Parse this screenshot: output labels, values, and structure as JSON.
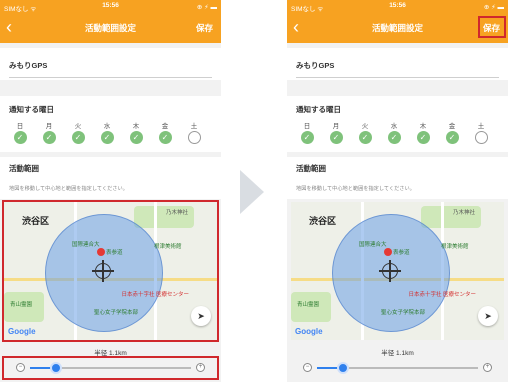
{
  "status": {
    "carrier": "SIMなし ᯤ",
    "time": "15:56",
    "battery": "⊕ ⚡ ▬"
  },
  "nav": {
    "back": "‹",
    "title": "活動範囲設定",
    "save": "保存"
  },
  "gps": {
    "label": "みもりGPS"
  },
  "days": {
    "label": "通知する曜日",
    "items": [
      {
        "label": "日",
        "checked": true
      },
      {
        "label": "月",
        "checked": true
      },
      {
        "label": "火",
        "checked": true
      },
      {
        "label": "水",
        "checked": true
      },
      {
        "label": "木",
        "checked": true
      },
      {
        "label": "金",
        "checked": true
      },
      {
        "label": "土",
        "checked": false
      }
    ]
  },
  "range": {
    "label": "活動範囲",
    "hint": "地図を移動して中心地と範囲を指定してください。"
  },
  "map": {
    "area": "渋谷区",
    "poi_1": "国際連合大",
    "poi_2": "表参道",
    "poi_3": "根津美術館",
    "poi_4": "日本赤十字社\n医療センター",
    "poi_5": "聖心女子学院本部",
    "poi_6": "乃木神社",
    "poi_7": "青山霊園",
    "google": "Google"
  },
  "radius": {
    "label": "半径 1.1km",
    "value_fraction": 0.15
  },
  "colors": {
    "accent": "#f7a221",
    "highlight": "#d0282d",
    "slider": "#2f80ed"
  }
}
